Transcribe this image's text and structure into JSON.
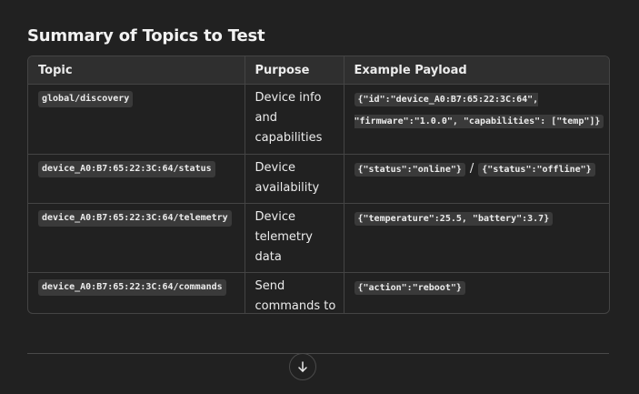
{
  "heading": "Summary of Topics to Test",
  "table": {
    "headers": [
      "Topic",
      "Purpose",
      "Example Payload"
    ],
    "rows": [
      {
        "topic": "global/discovery",
        "purpose": "Device info and capabilities",
        "payload": [
          "{\"id\":\"device_A0:B7:65:22:3C:64\", \"firmware\":\"1.0.0\", \"capabilities\": [\"temp\"]}"
        ]
      },
      {
        "topic": "device_A0:B7:65:22:3C:64/status",
        "purpose": "Device availability",
        "payload": [
          "{\"status\":\"online\"}",
          "{\"status\":\"offline\"}"
        ],
        "separator": "/"
      },
      {
        "topic": "device_A0:B7:65:22:3C:64/telemetry",
        "purpose": "Device telemetry data",
        "payload": [
          "{\"temperature\":25.5, \"battery\":3.7}"
        ]
      },
      {
        "topic": "device_A0:B7:65:22:3C:64/commands",
        "purpose": "Send commands to the device",
        "payload": [
          "{\"action\":\"reboot\"}"
        ]
      }
    ]
  },
  "scroll_button": {
    "icon": "arrow-down-icon"
  }
}
